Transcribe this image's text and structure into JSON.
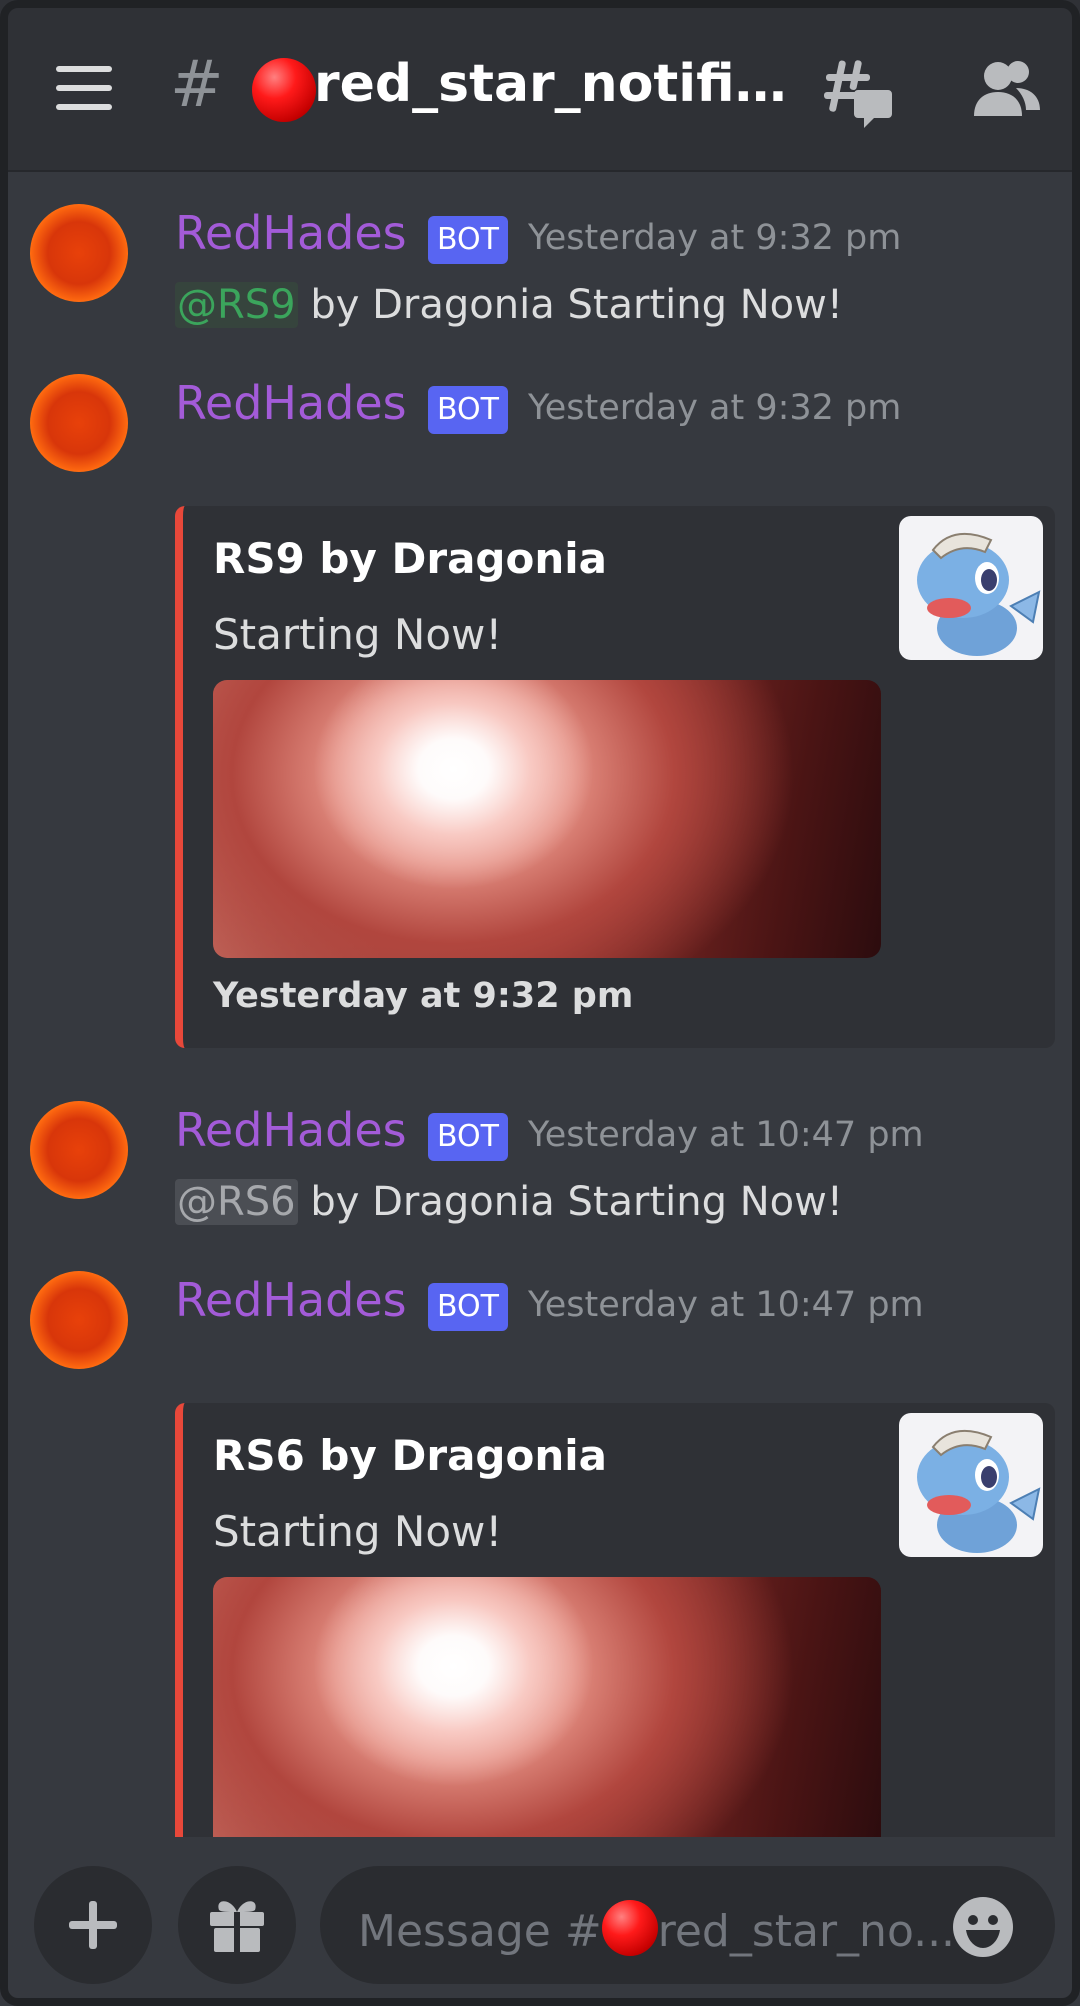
{
  "header": {
    "hash_symbol": "#",
    "channel_name": "red_star_notific...",
    "icons": [
      "hamburger-menu-icon",
      "channel-hash-icon",
      "red-circle-emoji-icon",
      "threads-icon",
      "members-icon"
    ]
  },
  "messages": [
    {
      "author": "RedHades",
      "bot_tag": "BOT",
      "time": "Yesterday at 9:32 pm",
      "mention": "@RS9",
      "text": " by Dragonia Starting Now!"
    },
    {
      "author": "RedHades",
      "bot_tag": "BOT",
      "time": "Yesterday at 9:32 pm",
      "embed": {
        "title": "RS9 by Dragonia",
        "description": "Starting Now!",
        "footer": "Yesterday at 9:32 pm"
      }
    },
    {
      "author": "RedHades",
      "bot_tag": "BOT",
      "time": "Yesterday at 10:47 pm",
      "mention": "@RS6",
      "text": " by Dragonia Starting Now!"
    },
    {
      "author": "RedHades",
      "bot_tag": "BOT",
      "time": "Yesterday at 10:47 pm",
      "embed": {
        "title": "RS6 by Dragonia",
        "description": "Starting Now!"
      }
    }
  ],
  "composer": {
    "placeholder_prefix": "Message #",
    "placeholder_suffix": "red_star_no...",
    "icons": [
      "plus-icon",
      "gift-icon",
      "emoji-icon"
    ]
  },
  "colors": {
    "background": "#36393f",
    "header": "#2f3136",
    "author": "#a35bd8",
    "bot_badge": "#5865f2",
    "embed_border": "#e8483a",
    "mention_green": "#3ba55c"
  }
}
